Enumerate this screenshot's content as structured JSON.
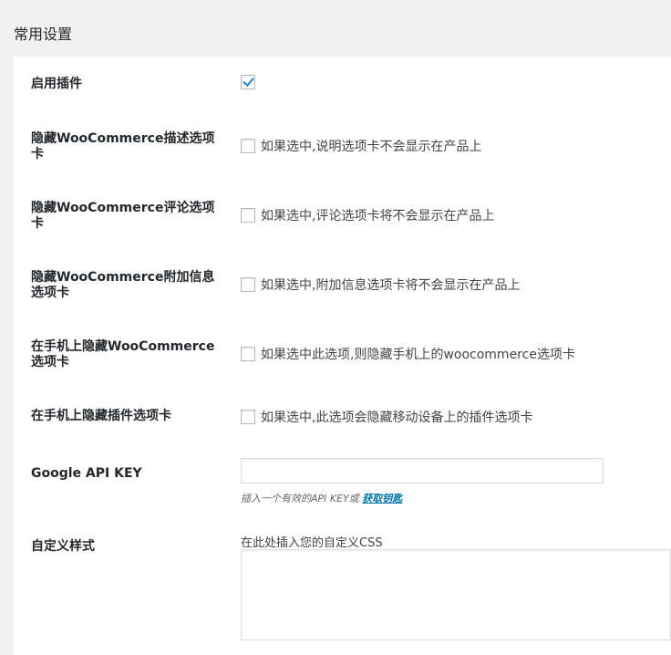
{
  "section_title": "常用设置",
  "settings": {
    "enable_plugin": {
      "label": "启用插件",
      "checked": true
    },
    "hide_description_tab": {
      "label": "隐藏WooCommerce描述选项卡",
      "desc": "如果选中,说明选项卡不会显示在产品上"
    },
    "hide_reviews_tab": {
      "label": "隐藏WooCommerce评论选项卡",
      "desc": "如果选中,评论选项卡将不会显示在产品上"
    },
    "hide_additional_info_tab": {
      "label": "隐藏WooCommerce附加信息选项卡",
      "desc": "如果选中,附加信息选项卡将不会显示在产品上"
    },
    "hide_wc_tabs_mobile": {
      "label": "在手机上隐藏WooCommerce选项卡",
      "desc": "如果选中此选项,则隐藏手机上的woocommerce选项卡"
    },
    "hide_plugin_tabs_mobile": {
      "label": "在手机上隐藏插件选项卡",
      "desc": "如果选中,此选项会隐藏移动设备上的插件选项卡"
    },
    "google_api_key": {
      "label": "Google API KEY",
      "value": "",
      "help_prefix": "插入一个有效的API KEY或",
      "help_link": "获取钥匙"
    },
    "custom_css": {
      "label": "自定义样式",
      "caption": "在此处插入您的自定义CSS",
      "value": ""
    }
  },
  "colors": {
    "checkmark": "#1e8cbe",
    "link": "#0073aa",
    "page_bg": "#f1f1f1",
    "panel_bg": "#ffffff"
  }
}
